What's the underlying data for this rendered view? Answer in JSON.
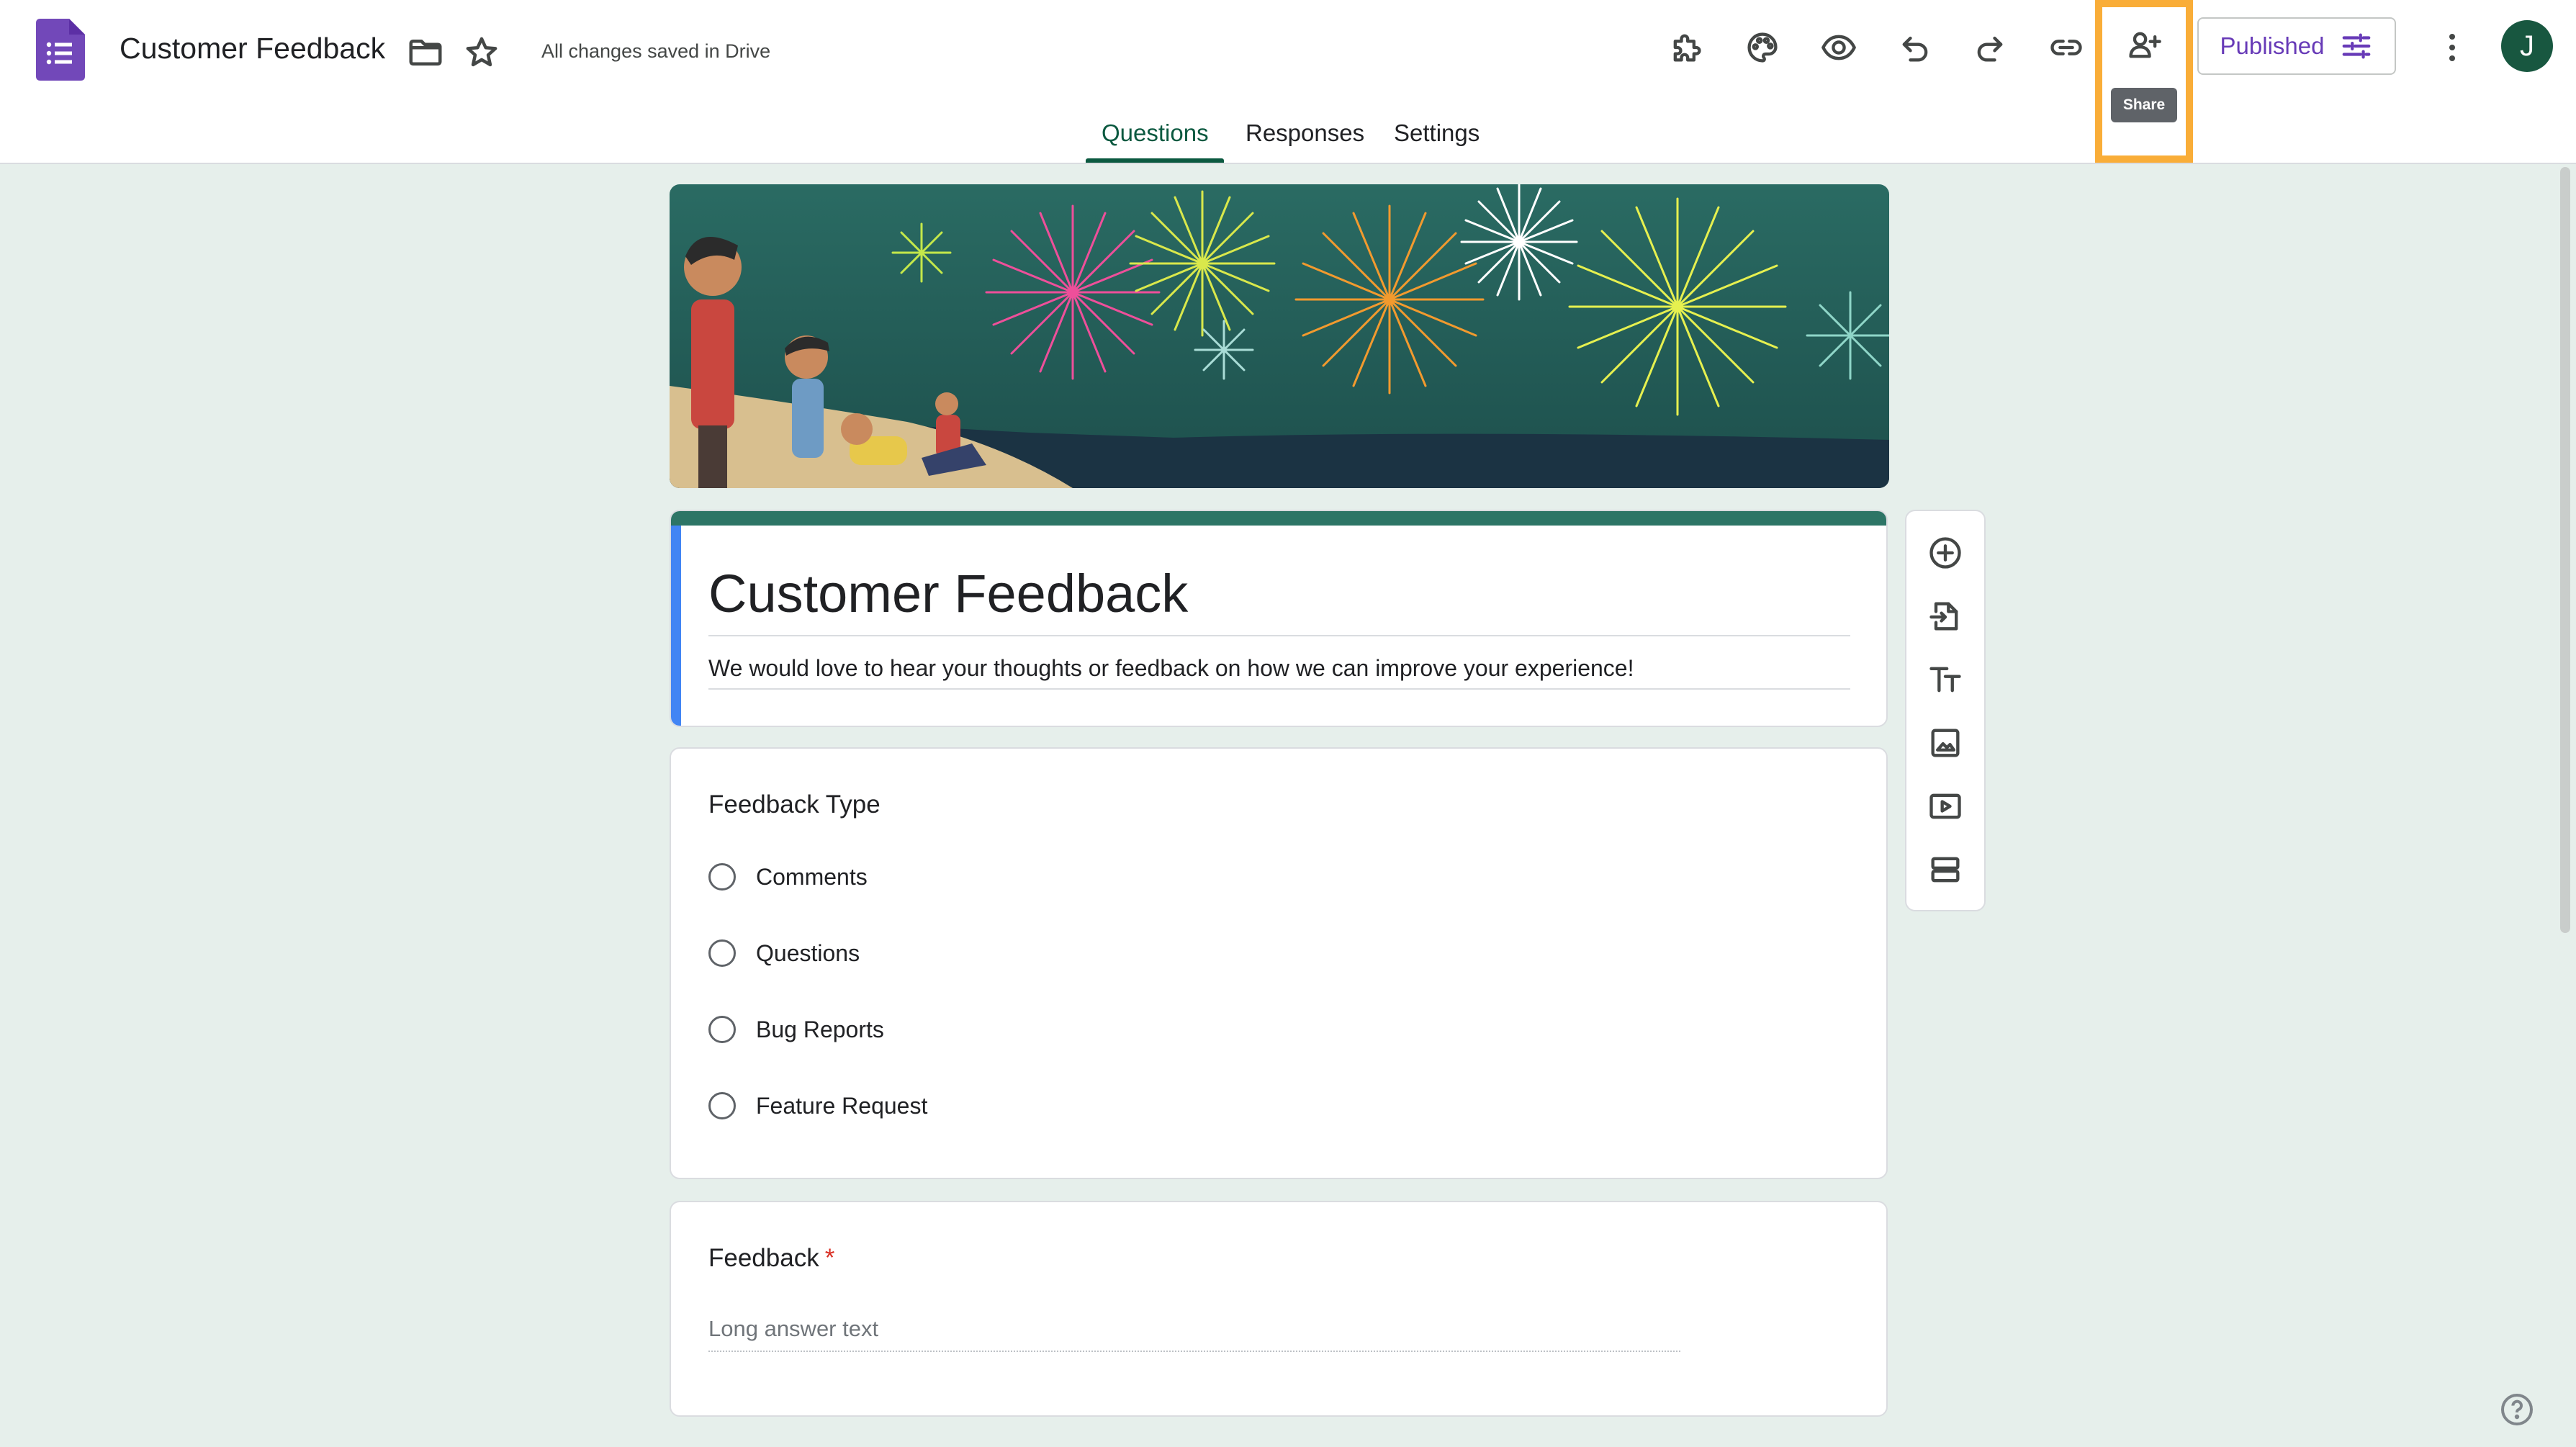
{
  "app": {
    "icon": "google-forms-logo",
    "doc_title": "Customer Feedback",
    "save_status": "All changes saved in Drive",
    "brand_color": "#673ab7",
    "theme_color": "#2d7566"
  },
  "toolbar": {
    "items": [
      {
        "name": "add-ons-icon"
      },
      {
        "name": "palette-icon"
      },
      {
        "name": "preview-eye-icon"
      },
      {
        "name": "undo-icon"
      },
      {
        "name": "redo-icon"
      },
      {
        "name": "link-icon"
      },
      {
        "name": "share-person-add-icon"
      }
    ],
    "share_tooltip": "Share",
    "publish_label": "Published",
    "avatar_initial": "J"
  },
  "tabs": [
    {
      "label": "Questions",
      "active": true
    },
    {
      "label": "Responses",
      "active": false
    },
    {
      "label": "Settings",
      "active": false
    }
  ],
  "form": {
    "title": "Customer Feedback",
    "description": "We would love to hear your thoughts or feedback on how we can improve your experience!",
    "questions": [
      {
        "title": "Feedback Type",
        "type": "multiple-choice",
        "options": [
          "Comments",
          "Questions",
          "Bug Reports",
          "Feature Request"
        ]
      },
      {
        "title": "Feedback",
        "required_marker": "*",
        "type": "paragraph",
        "placeholder": "Long answer text"
      }
    ]
  },
  "side_toolbar": [
    "add-question-icon",
    "import-questions-icon",
    "add-title-icon",
    "add-image-icon",
    "add-video-icon",
    "add-section-icon"
  ]
}
